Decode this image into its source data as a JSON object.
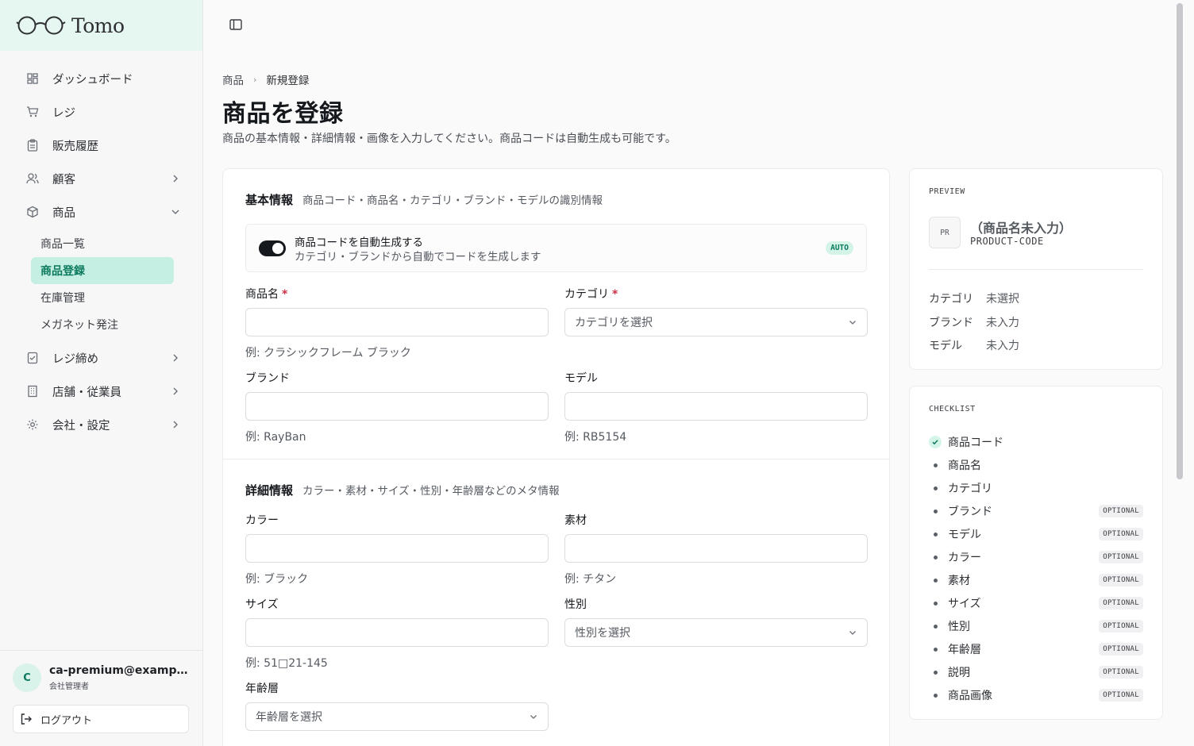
{
  "brand": {
    "name": "Tomo"
  },
  "sidebar": {
    "items": [
      {
        "label": "ダッシュボード",
        "icon": "dashboard-icon",
        "expand": "none"
      },
      {
        "label": "レジ",
        "icon": "cart-icon",
        "expand": "none"
      },
      {
        "label": "販売履歴",
        "icon": "clipboard-icon",
        "expand": "none"
      },
      {
        "label": "顧客",
        "icon": "users-icon",
        "expand": "right"
      },
      {
        "label": "商品",
        "icon": "package-icon",
        "expand": "down"
      },
      {
        "label": "レジ締め",
        "icon": "register-close-icon",
        "expand": "right"
      },
      {
        "label": "店舗・従業員",
        "icon": "building-icon",
        "expand": "right"
      },
      {
        "label": "会社・設定",
        "icon": "gear-icon",
        "expand": "right"
      }
    ],
    "sub_items": [
      {
        "label": "商品一覧",
        "active": false
      },
      {
        "label": "商品登録",
        "active": true
      },
      {
        "label": "在庫管理",
        "active": false
      },
      {
        "label": "メガネット発注",
        "active": false
      }
    ],
    "user": {
      "initial": "C",
      "email": "ca-premium@example.com",
      "role": "会社管理者"
    },
    "logout_label": "ログアウト"
  },
  "breadcrumb": {
    "parent": "商品",
    "current": "新規登録"
  },
  "page": {
    "title": "商品を登録",
    "description": "商品の基本情報・詳細情報・画像を入力してください。商品コードは自動生成も可能です。"
  },
  "basic": {
    "title": "基本情報",
    "subtitle": "商品コード・商品名・カテゴリ・ブランド・モデルの識別情報",
    "auto_code": {
      "title": "商品コードを自動生成する",
      "subtitle": "カテゴリ・ブランドから自動でコードを生成します",
      "badge": "AUTO",
      "enabled": true
    },
    "fields": {
      "name": {
        "label": "商品名",
        "required": "*",
        "value": "",
        "hint": "例: クラシックフレーム ブラック"
      },
      "category": {
        "label": "カテゴリ",
        "required": "*",
        "placeholder": "カテゴリを選択"
      },
      "brand": {
        "label": "ブランド",
        "value": "",
        "hint": "例: RayBan"
      },
      "model": {
        "label": "モデル",
        "value": "",
        "hint": "例: RB5154"
      }
    }
  },
  "detail": {
    "title": "詳細情報",
    "subtitle": "カラー・素材・サイズ・性別・年齢層などのメタ情報",
    "fields": {
      "color": {
        "label": "カラー",
        "value": "",
        "hint": "例: ブラック"
      },
      "material": {
        "label": "素材",
        "value": "",
        "hint": "例: チタン"
      },
      "size": {
        "label": "サイズ",
        "value": "",
        "hint": "例: 51□21-145"
      },
      "gender": {
        "label": "性別",
        "placeholder": "性別を選択"
      },
      "age": {
        "label": "年齢層",
        "placeholder": "年齢層を選択"
      }
    }
  },
  "preview": {
    "label": "PREVIEW",
    "thumb": "PR",
    "name": "（商品名未入力）",
    "code": "PRODUCT-CODE",
    "rows": [
      {
        "key": "カテゴリ",
        "value": "未選択"
      },
      {
        "key": "ブランド",
        "value": "未入力"
      },
      {
        "key": "モデル",
        "value": "未入力"
      }
    ]
  },
  "checklist": {
    "label": "CHECKLIST",
    "optional_label": "OPTIONAL",
    "items": [
      {
        "label": "商品コード",
        "done": true,
        "optional": false
      },
      {
        "label": "商品名",
        "done": false,
        "optional": false
      },
      {
        "label": "カテゴリ",
        "done": false,
        "optional": false
      },
      {
        "label": "ブランド",
        "done": false,
        "optional": true
      },
      {
        "label": "モデル",
        "done": false,
        "optional": true
      },
      {
        "label": "カラー",
        "done": false,
        "optional": true
      },
      {
        "label": "素材",
        "done": false,
        "optional": true
      },
      {
        "label": "サイズ",
        "done": false,
        "optional": true
      },
      {
        "label": "性別",
        "done": false,
        "optional": true
      },
      {
        "label": "年齢層",
        "done": false,
        "optional": true
      },
      {
        "label": "説明",
        "done": false,
        "optional": true
      },
      {
        "label": "商品画像",
        "done": false,
        "optional": true
      }
    ]
  },
  "colors": {
    "accent": "#0b7a5e",
    "accent_bg": "#c6efe3",
    "required": "#d0304a"
  }
}
